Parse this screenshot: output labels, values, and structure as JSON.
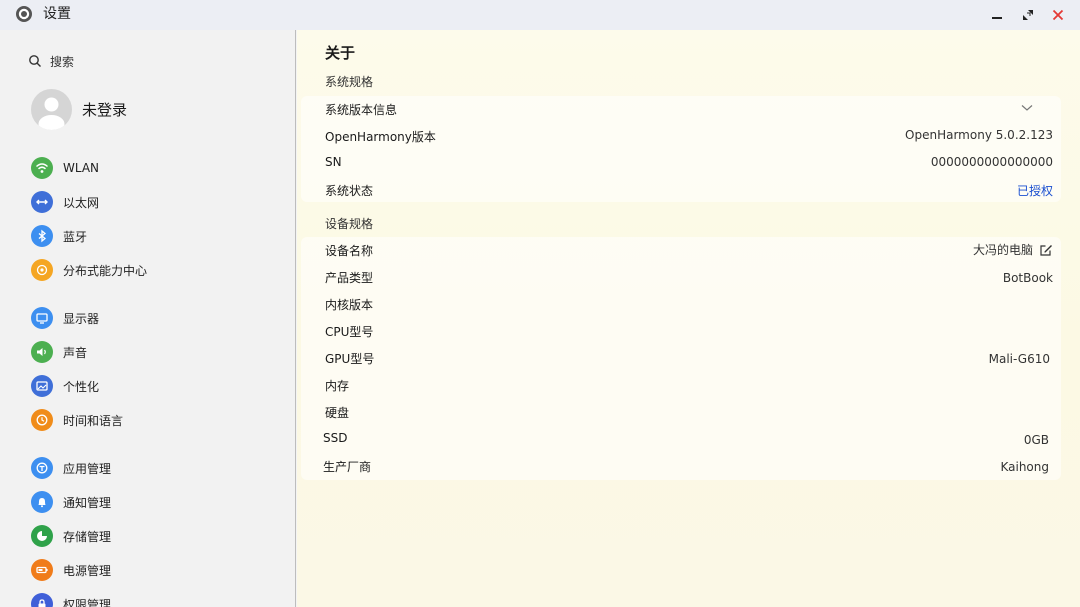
{
  "window": {
    "title": "设置"
  },
  "sidebar": {
    "search_label": "搜索",
    "user_name": "未登录",
    "items": [
      {
        "label": "WLAN",
        "icon": "wifi-icon",
        "color": "#4caf50"
      },
      {
        "label": "以太网",
        "icon": "ethernet-icon",
        "color": "#3f6fd8"
      },
      {
        "label": "蓝牙",
        "icon": "bluetooth-icon",
        "color": "#3d8ff0"
      },
      {
        "label": "分布式能力中心",
        "icon": "distributed-icon",
        "color": "#f5a623"
      },
      {
        "label": "显示器",
        "icon": "display-icon",
        "color": "#3d8ff0"
      },
      {
        "label": "声音",
        "icon": "sound-icon",
        "color": "#4caf50"
      },
      {
        "label": "个性化",
        "icon": "personalize-icon",
        "color": "#3f6fd8"
      },
      {
        "label": "时间和语言",
        "icon": "clock-icon",
        "color": "#f08c1a"
      },
      {
        "label": "应用管理",
        "icon": "apps-icon",
        "color": "#3d8ff0"
      },
      {
        "label": "通知管理",
        "icon": "bell-icon",
        "color": "#3d8ff0"
      },
      {
        "label": "存储管理",
        "icon": "storage-icon",
        "color": "#2fa24a"
      },
      {
        "label": "电源管理",
        "icon": "battery-icon",
        "color": "#f07c1a"
      },
      {
        "label": "权限管理",
        "icon": "lock-icon",
        "color": "#3f5fd8"
      }
    ]
  },
  "about": {
    "title": "关于",
    "system_section": "系统规格",
    "version_info": "系统版本信息",
    "openharmony_label": "OpenHarmony版本",
    "openharmony_value": "OpenHarmony 5.0.2.123",
    "sn_label": "SN",
    "sn_value": "0000000000000000",
    "status_label": "系统状态",
    "status_value": "已授权",
    "device_section": "设备规格",
    "device_name_label": "设备名称",
    "device_name_value": "大冯的电脑",
    "product_type_label": "产品类型",
    "product_type_value": "BotBook",
    "kernel_label": "内核版本",
    "cpu_label": "CPU型号",
    "gpu_label": "GPU型号",
    "gpu_value": "Mali-G610",
    "memory_label": "内存",
    "disk_label": "硬盘",
    "ssd_label": "SSD",
    "ssd_value": "0GB",
    "manufacturer_label": "生产厂商",
    "manufacturer_value": "Kaihong"
  },
  "colors": {
    "link": "#1a4fd0",
    "close": "#e53935"
  }
}
